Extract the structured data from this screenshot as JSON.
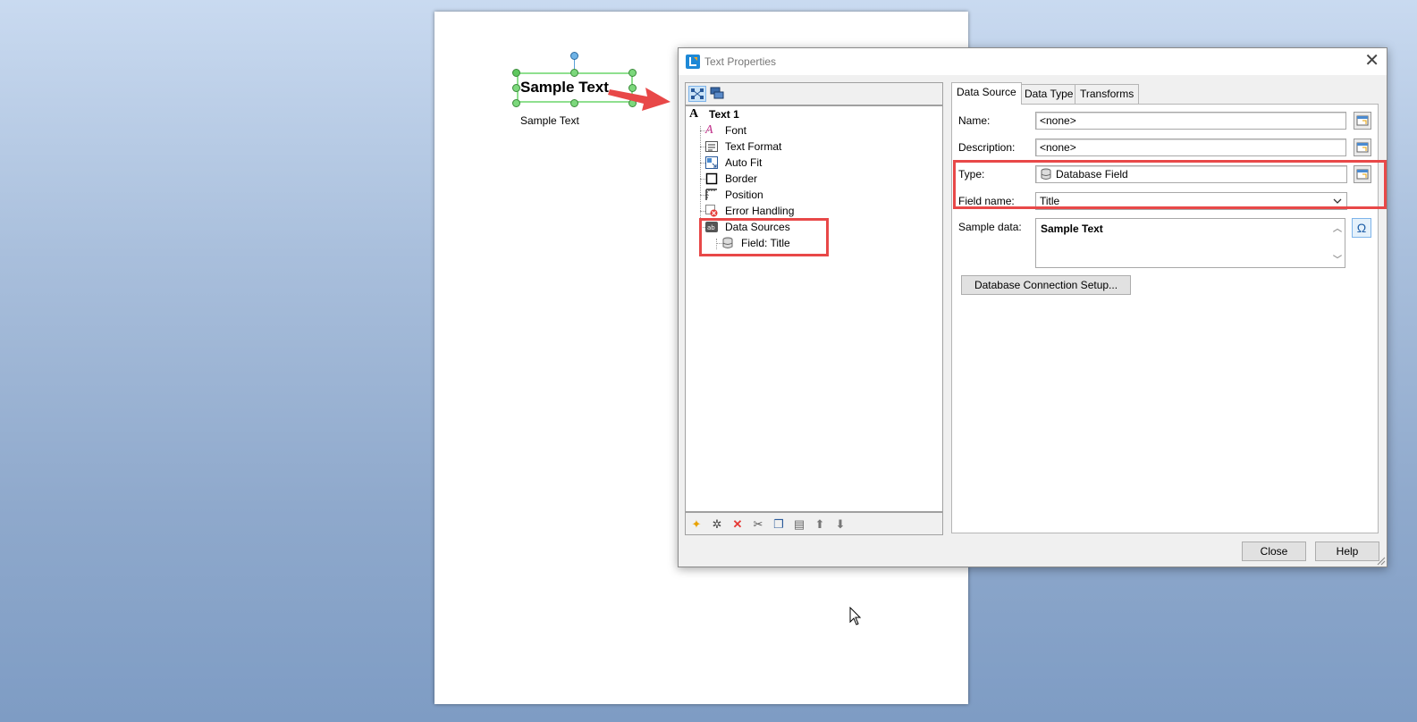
{
  "canvas": {
    "sample_big": "Sample Text",
    "sample_small": "Sample Text"
  },
  "dialog": {
    "title": "Text Properties",
    "close_glyph": "✕"
  },
  "tree": {
    "items": [
      {
        "label": "Text 1",
        "icon": "text-object-icon"
      },
      {
        "label": "Font",
        "icon": "font-icon"
      },
      {
        "label": "Text Format",
        "icon": "text-format-icon"
      },
      {
        "label": "Auto Fit",
        "icon": "auto-fit-icon"
      },
      {
        "label": "Border",
        "icon": "border-icon"
      },
      {
        "label": "Position",
        "icon": "position-icon"
      },
      {
        "label": "Error Handling",
        "icon": "error-handling-icon"
      },
      {
        "label": "Data Sources",
        "icon": "data-sources-icon"
      },
      {
        "label": "Field: Title",
        "icon": "database-field-icon"
      }
    ]
  },
  "tabs": [
    "Data Source",
    "Data Type",
    "Transforms"
  ],
  "form": {
    "name_label": "Name:",
    "name_value": "<none>",
    "description_label": "Description:",
    "description_value": "<none>",
    "type_label": "Type:",
    "type_value": "Database Field",
    "field_name_label": "Field name:",
    "field_name_value": "Title",
    "sample_data_label": "Sample data:",
    "sample_data_value": "Sample Text",
    "omega_glyph": "Ω",
    "db_setup_button": "Database Connection Setup..."
  },
  "footer": {
    "close_button": "Close",
    "help_button": "Help"
  },
  "colors": {
    "highlight": "#e84848",
    "selection": "#8fe08f"
  }
}
